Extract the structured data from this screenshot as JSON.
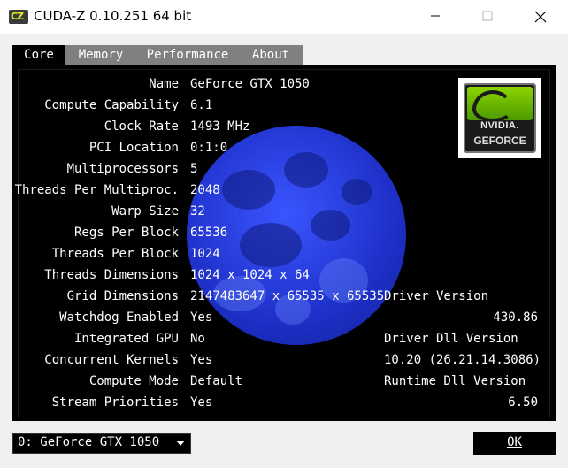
{
  "window": {
    "title": "CUDA-Z 0.10.251 64 bit",
    "icon_text": "CZ"
  },
  "tabs": [
    {
      "label": "Core",
      "active": true
    },
    {
      "label": "Memory",
      "active": false
    },
    {
      "label": "Performance",
      "active": false
    },
    {
      "label": "About",
      "active": false
    }
  ],
  "core": {
    "rows": [
      {
        "label": "Name",
        "value": "GeForce GTX 1050"
      },
      {
        "label": "Compute Capability",
        "value": "6.1"
      },
      {
        "label": "Clock Rate",
        "value": "1493 MHz"
      },
      {
        "label": "PCI Location",
        "value": "0:1:0"
      },
      {
        "label": "Multiprocessors",
        "value": "5"
      },
      {
        "label": "Threads Per Multiproc.",
        "value": "2048"
      },
      {
        "label": "Warp Size",
        "value": "32"
      },
      {
        "label": "Regs Per Block",
        "value": "65536"
      },
      {
        "label": "Threads Per Block",
        "value": "1024"
      },
      {
        "label": "Threads Dimensions",
        "value": "1024 x 1024 x 64"
      },
      {
        "label": "Grid Dimensions",
        "value": "2147483647 x 65535 x 65535"
      },
      {
        "label": "Watchdog Enabled",
        "value": "Yes"
      },
      {
        "label": "Integrated GPU",
        "value": "No"
      },
      {
        "label": "Concurrent Kernels",
        "value": "Yes"
      },
      {
        "label": "Compute Mode",
        "value": "Default"
      },
      {
        "label": "Stream Priorities",
        "value": "Yes"
      }
    ],
    "driver_version_label": "Driver Version",
    "driver_version_value": "430.86",
    "driver_dll_label": "Driver Dll Version",
    "driver_dll_value": "10.20 (26.21.14.3086)",
    "runtime_dll_label": "Runtime Dll Version",
    "runtime_dll_value": "6.50",
    "logo_text_top": "NVIDIA.",
    "logo_text_bottom": "GEFORCE"
  },
  "device_select": {
    "selected": "0: GeForce GTX 1050"
  },
  "ok_button": "OK"
}
